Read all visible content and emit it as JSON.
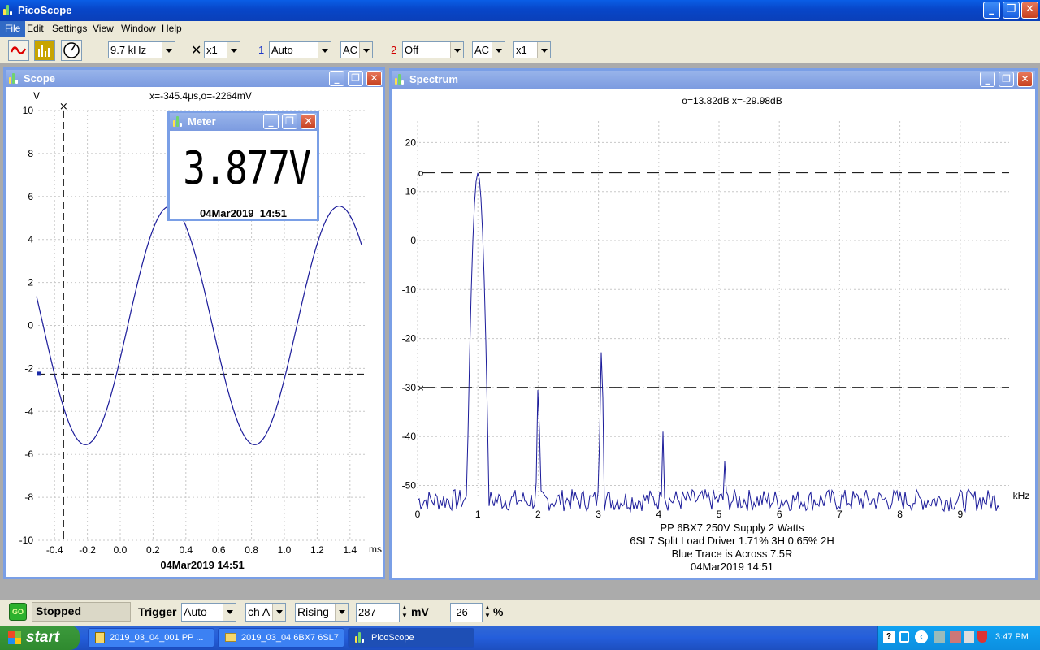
{
  "app": {
    "title": "PicoScope"
  },
  "menu": [
    "File",
    "Edit",
    "Settings",
    "View",
    "Window",
    "Help"
  ],
  "toolbar": {
    "timebase": "9.7 kHz",
    "multiplier": "x1",
    "ch1_label": "1",
    "ch1_range": "Auto",
    "ch1_coupling": "AC",
    "ch2_label": "2",
    "ch2_range": "Off",
    "ch2_coupling": "AC",
    "ch2_multiplier": "x1"
  },
  "scope": {
    "title": "Scope",
    "readout": "x=-345.4µs,o=-2264mV",
    "y_unit": "V",
    "x_unit": "ms",
    "y_ticks": [
      "10",
      "8",
      "6",
      "4",
      "2",
      "0",
      "-2",
      "-4",
      "-6",
      "-8",
      "-10"
    ],
    "x_ticks": [
      "-0.4",
      "-0.2",
      "0.0",
      "0.2",
      "0.4",
      "0.6",
      "0.8",
      "1.0",
      "1.2",
      "1.4"
    ],
    "date": "04Mar2019  14:51",
    "cursor_x_ms": -0.345,
    "cursor_o_v": -2.264,
    "wave": {
      "amplitude": 5.55,
      "frequency_khz": 0.97,
      "phase_deg": -16
    }
  },
  "meter": {
    "title": "Meter",
    "reading": "3.877V",
    "date": "04Mar2019  14:51"
  },
  "spectrum": {
    "title": "Spectrum",
    "readout": "o=13.82dB  x=-29.98dB",
    "y_ticks": [
      "20",
      "10",
      "0",
      "-10",
      "-20",
      "-30",
      "-40",
      "-50"
    ],
    "x_ticks": [
      "0",
      "1",
      "2",
      "3",
      "4",
      "5",
      "6",
      "7",
      "8",
      "9"
    ],
    "x_unit": "kHz",
    "cursor_o_db": 13.82,
    "cursor_x_db": -29.98,
    "caption": [
      "PP 6BX7 250V Supply 2 Watts",
      "6SL7 Split Load Driver 1.71% 3H 0.65% 2H",
      "Blue Trace is Across 7.5R"
    ],
    "date": "04Mar2019  14:51",
    "peaks": [
      {
        "khz": 1.0,
        "db": 13.8
      },
      {
        "khz": 2.0,
        "db": -30.0
      },
      {
        "khz": 3.05,
        "db": -22.5
      },
      {
        "khz": 4.07,
        "db": -39.0
      },
      {
        "khz": 5.1,
        "db": -44.5
      }
    ],
    "noise_floor_db": -53
  },
  "status": {
    "go": "GO",
    "state": "Stopped",
    "trigger_label": "Trigger",
    "trigger_mode": "Auto",
    "trigger_channel": "ch A",
    "trigger_edge": "Rising",
    "trigger_level": "287",
    "level_unit": "mV",
    "pretrigger": "-26",
    "pretrigger_unit": "%"
  },
  "taskbar": {
    "start": "start",
    "tasks": [
      "2019_03_04_001 PP ...",
      "2019_03_04 6BX7 6SL7",
      "PicoScope"
    ],
    "clock": "3:47 PM"
  }
}
